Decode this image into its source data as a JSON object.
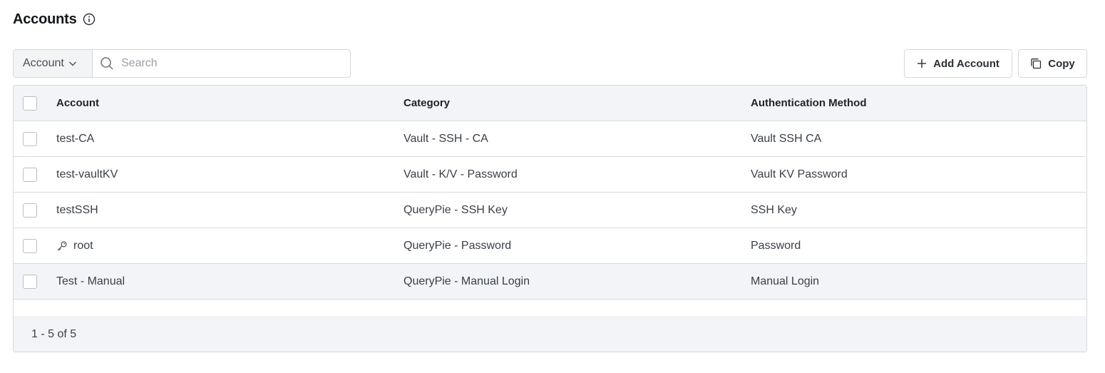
{
  "header": {
    "title": "Accounts",
    "info_icon": "info-icon"
  },
  "toolbar": {
    "filter_label": "Account",
    "search_placeholder": "Search",
    "search_value": "",
    "add_label": "Add Account",
    "copy_label": "Copy"
  },
  "table": {
    "columns": [
      "Account",
      "Category",
      "Authentication Method"
    ],
    "rows": [
      {
        "account": "test-CA",
        "category": "Vault - SSH - CA",
        "auth": "Vault SSH CA",
        "icon": ""
      },
      {
        "account": "test-vaultKV",
        "category": "Vault - K/V - Password",
        "auth": "Vault KV Password",
        "icon": ""
      },
      {
        "account": "testSSH",
        "category": "QueryPie - SSH Key",
        "auth": "SSH Key",
        "icon": ""
      },
      {
        "account": "root",
        "category": "QueryPie - Password",
        "auth": "Password",
        "icon": "key-icon"
      },
      {
        "account": "Test - Manual",
        "category": "QueryPie - Manual Login",
        "auth": "Manual Login",
        "icon": ""
      }
    ]
  },
  "pagination": {
    "summary": "1 - 5 of 5"
  }
}
